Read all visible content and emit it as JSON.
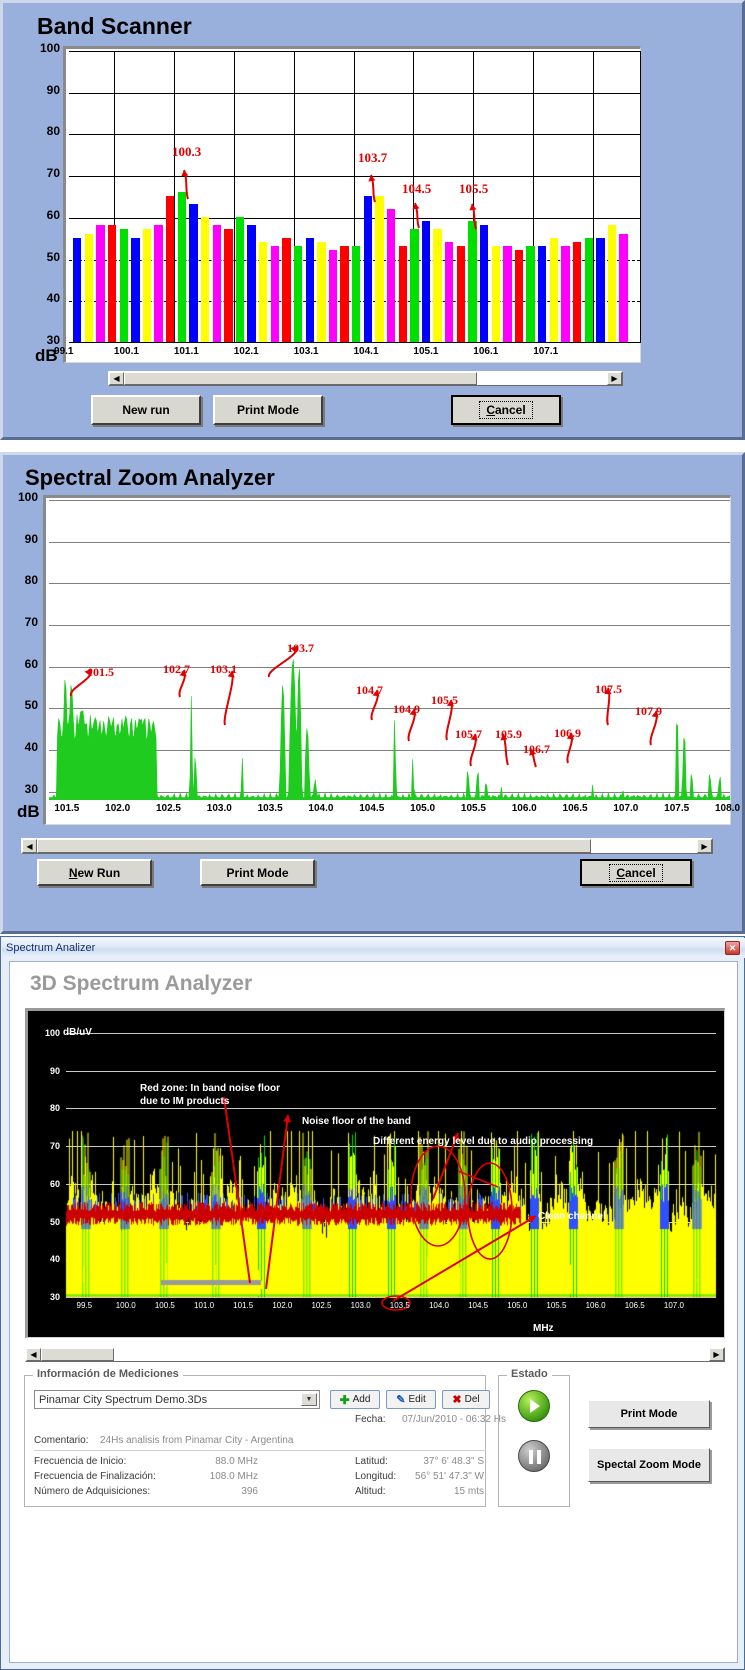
{
  "band_scanner": {
    "title": "Band Scanner",
    "y_unit": "dB",
    "buttons": {
      "new_run": "New run",
      "print_mode": "Print Mode",
      "cancel": "Cancel"
    }
  },
  "spectral_zoom": {
    "title": "Spectral Zoom Analyzer",
    "y_unit": "dB",
    "buttons": {
      "new_run": "New Run",
      "print_mode": "Print Mode",
      "cancel": "Cancel"
    }
  },
  "window3d": {
    "titlebar": "Spectrum Analizer",
    "close_label": "x",
    "heading": "3D Spectrum Analyzer",
    "y_unit": "dB/uV",
    "x_unit": "MHz",
    "annotations": [
      "Red zone: In band noise floor",
      "due to IM products",
      "Noise floor of the band",
      "Different energy level due to audio processing",
      "Clean channel"
    ],
    "info_group_label": "Información de Mediciones",
    "file_selected": "Pinamar City Spectrum Demo.3Ds",
    "btn_add": "Add",
    "btn_edit": "Edit",
    "btn_del": "Del",
    "fecha_label": "Fecha:",
    "fecha_value": "07/Jun/2010 - 06:32 Hs",
    "comentario_label": "Comentario:",
    "comentario_value": "24Hs analisis from Pinamar City - Argentina",
    "fields_left": [
      {
        "label": "Frecuencia de Inicio:",
        "value": "88.0 MHz"
      },
      {
        "label": "Frecuencia de Finalización:",
        "value": "108.0 MHz"
      },
      {
        "label": "Número de Adquisiciones:",
        "value": "396"
      }
    ],
    "fields_right": [
      {
        "label": "Latitud:",
        "value": "37° 6' 48.3\" S"
      },
      {
        "label": "Longitud:",
        "value": "56° 51' 47.3\" W"
      },
      {
        "label": "Altitud:",
        "value": "15 mts"
      }
    ],
    "estado_label": "Estado",
    "play_icon": "play-icon",
    "pause_icon": "pause-icon",
    "btn_print_mode": "Print Mode",
    "btn_spectal_zoom": "Spectal Zoom Mode"
  },
  "colors": {
    "panel_bg": "#9ab0dc",
    "annotation_red": "#e00000",
    "trace_green": "#1ecb1e",
    "bar_cycle": [
      "#0000ff",
      "#ffff00",
      "#ff00ff",
      "#ff0000",
      "#00e000"
    ]
  },
  "chart_data": [
    {
      "type": "bar",
      "title": "Band Scanner",
      "xlabel": "",
      "ylabel": "dB",
      "ylim": [
        30,
        100
      ],
      "yticks": [
        30,
        40,
        50,
        60,
        70,
        80,
        90,
        100
      ],
      "xticks": [
        "99.1",
        "100.1",
        "101.1",
        "102.1",
        "103.1",
        "104.1",
        "105.1",
        "106.1",
        "107.1"
      ],
      "grid": true,
      "bar_colors": [
        "#0000ff",
        "#ffff00",
        "#ff00ff",
        "#ff0000",
        "#00e000"
      ],
      "values": [
        55,
        56,
        58,
        58,
        57,
        55,
        57,
        58,
        65,
        66,
        63,
        60,
        58,
        57,
        60,
        58,
        54,
        53,
        55,
        53,
        55,
        54,
        52,
        53,
        53,
        65,
        65,
        62,
        53,
        57,
        59,
        57,
        54,
        53,
        59,
        58,
        53,
        53,
        52,
        53,
        53,
        55,
        53,
        54,
        55,
        55,
        58,
        56
      ],
      "annotations": [
        {
          "text": "100.3",
          "value": 66
        },
        {
          "text": "103.7",
          "value": 65
        },
        {
          "text": "104.5",
          "value": 59
        },
        {
          "text": "105.5",
          "value": 58
        }
      ]
    },
    {
      "type": "area",
      "title": "Spectral Zoom Analyzer",
      "xlabel": "",
      "ylabel": "dB",
      "ylim": [
        28,
        100
      ],
      "yticks": [
        30,
        40,
        50,
        60,
        70,
        80,
        90,
        100
      ],
      "xticks": [
        "101.5",
        "102.0",
        "102.5",
        "103.0",
        "103.5",
        "104.0",
        "104.5",
        "105.0",
        "105.5",
        "106.0",
        "106.5",
        "107.0",
        "107.5",
        "108.0"
      ],
      "xlim": [
        101.3,
        108.0
      ],
      "grid": true,
      "trace_color": "#1ecb1e",
      "annotations": [
        {
          "text": "101.5",
          "freq": 101.5,
          "peak": 57
        },
        {
          "text": "102.7",
          "freq": 102.7,
          "peak": 53
        },
        {
          "text": "103.1",
          "freq": 103.1,
          "peak": 39
        },
        {
          "text": "103.7",
          "freq": 103.7,
          "peak": 62
        },
        {
          "text": "104.7",
          "freq": 104.7,
          "peak": 49
        },
        {
          "text": "104.9",
          "freq": 104.9,
          "peak": 39
        },
        {
          "text": "105.5",
          "freq": 105.5,
          "peak": 36
        },
        {
          "text": "105.7",
          "freq": 105.7,
          "peak": 30
        },
        {
          "text": "105.9",
          "freq": 105.9,
          "peak": 30
        },
        {
          "text": "106.7",
          "freq": 106.7,
          "peak": 32
        },
        {
          "text": "106.9",
          "freq": 106.9,
          "peak": 32
        },
        {
          "text": "107.5",
          "freq": 107.5,
          "peak": 50
        },
        {
          "text": "107.9",
          "freq": 107.9,
          "peak": 35
        }
      ]
    },
    {
      "type": "line",
      "title": "3D Spectrum Analyzer",
      "xlabel": "MHz",
      "ylabel": "dB/uV",
      "ylim": [
        30,
        100
      ],
      "yticks": [
        30,
        40,
        50,
        60,
        70,
        80,
        90,
        100
      ],
      "xticks": [
        "99.5",
        "100.0",
        "100.5",
        "101.0",
        "101.5",
        "102.0",
        "102.5",
        "103.0",
        "103.5",
        "104.0",
        "104.5",
        "105.0",
        "105.5",
        "106.0",
        "106.5",
        "107.0"
      ],
      "grid": true,
      "series": [
        {
          "name": "peak-hold",
          "color": "#ffff00"
        },
        {
          "name": "average",
          "color": "#00e000"
        },
        {
          "name": "noise-floor",
          "color": "#cc0000"
        },
        {
          "name": "trace-blue",
          "color": "#3050ff"
        }
      ]
    }
  ]
}
